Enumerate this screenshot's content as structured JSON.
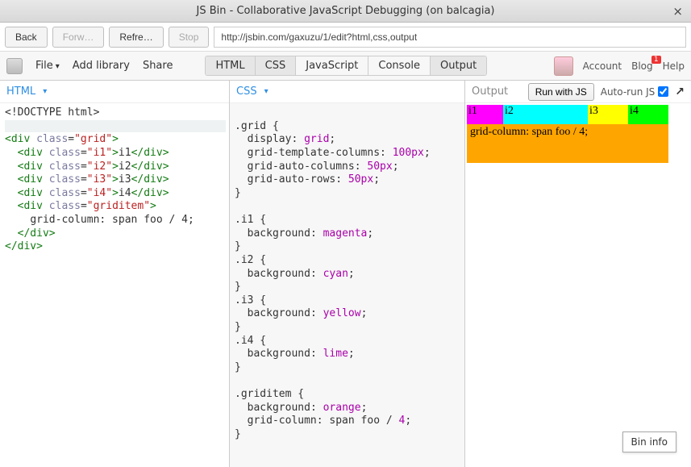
{
  "window": {
    "title": "JS Bin - Collaborative JavaScript Debugging (on balcagia)"
  },
  "nav": {
    "back": "Back",
    "forward": "Forw…",
    "refresh": "Refre…",
    "stop": "Stop",
    "url": "http://jsbin.com/gaxuzu/1/edit?html,css,output"
  },
  "toolbar": {
    "file": "File",
    "add_library": "Add library",
    "share": "Share",
    "tabs": {
      "html": "HTML",
      "css": "CSS",
      "javascript": "JavaScript",
      "console": "Console",
      "output": "Output"
    },
    "account": "Account",
    "blog": "Blog",
    "blog_badge": "1",
    "help": "Help"
  },
  "panes": {
    "html_label": "HTML",
    "css_label": "CSS",
    "output_label": "Output",
    "run_label": "Run with JS",
    "autorun_label": "Auto-run JS"
  },
  "html_code": {
    "l1": "<!DOCTYPE html>",
    "l3_open": "<div",
    "l3_attr": "class",
    "l3_val": "\"grid\"",
    "l3_close": ">",
    "l4_open": "<div",
    "l4_attr": "class",
    "l4_val": "\"i1\"",
    "l4_text": "i1",
    "l4_end": "</div>",
    "l5_open": "<div",
    "l5_attr": "class",
    "l5_val": "\"i2\"",
    "l5_text": "i2",
    "l5_end": "</div>",
    "l6_open": "<div",
    "l6_attr": "class",
    "l6_val": "\"i3\"",
    "l6_text": "i3",
    "l6_end": "</div>",
    "l7_open": "<div",
    "l7_attr": "class",
    "l7_val": "\"i4\"",
    "l7_text": "i4",
    "l7_end": "</div>",
    "l8_open": "<div",
    "l8_attr": "class",
    "l8_val": "\"griditem\"",
    "l8_close": ">",
    "l9_text": "grid-column: span foo / 4;",
    "l10": "</div>",
    "l11": "</div>"
  },
  "css_code": {
    "s_grid": ".grid {",
    "p_display_k": "display",
    "p_display_v": "grid",
    "p_gtc_k": "grid-template-columns",
    "p_gtc_v": "100px",
    "p_gac_k": "grid-auto-columns",
    "p_gac_v": "50px",
    "p_gar_k": "grid-auto-rows",
    "p_gar_v": "50px",
    "close": "}",
    "s_i1": ".i1 {",
    "p_i1_k": "background",
    "p_i1_v": "magenta",
    "s_i2": ".i2 {",
    "p_i2_k": "background",
    "p_i2_v": "cyan",
    "s_i3": ".i3 {",
    "p_i3_k": "background",
    "p_i3_v": "yellow",
    "s_i4": ".i4 {",
    "p_i4_k": "background",
    "p_i4_v": "lime",
    "s_gi": ".griditem {",
    "p_gi_bg_k": "background",
    "p_gi_bg_v": "orange",
    "p_gi_gc_k": "grid-column",
    "p_gi_gc_pre": "span foo / ",
    "p_gi_gc_num": "4"
  },
  "output_render": {
    "i1": "i1",
    "i2": "i2",
    "i3": "i3",
    "i4": "i4",
    "griditem_text": "grid-column: span foo / 4;"
  },
  "bin_info": "Bin info"
}
